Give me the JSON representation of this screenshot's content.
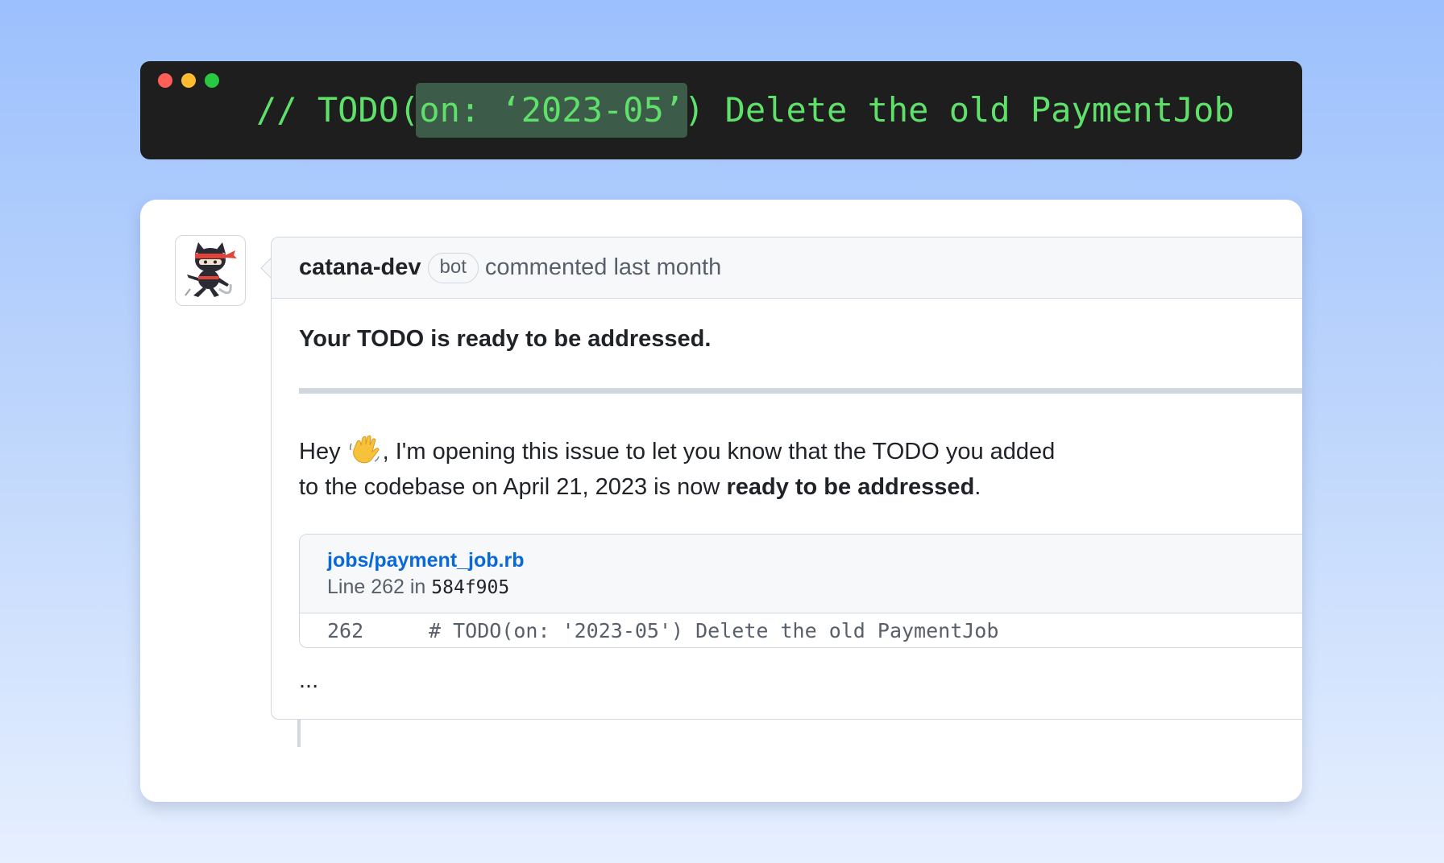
{
  "terminal": {
    "code_prefix": "// TODO(",
    "code_highlight": "on: ‘2023-05’",
    "code_suffix": ") Delete the old PaymentJob"
  },
  "comment": {
    "author": "catana-dev",
    "badge": "bot",
    "action": "commented last month",
    "headline": "Your TODO is ready to be addressed.",
    "body_part1": "Hey ",
    "body_part2": ", I'm opening this issue to let you know that the TODO you added",
    "body_part3": "to the codebase on April 21, 2023 is now ",
    "body_bold": "ready to be addressed",
    "body_end": ".",
    "ellipsis": "..."
  },
  "file_ref": {
    "path": "jobs/payment_job.rb",
    "meta_prefix": "Line 262 in ",
    "sha": "584f905",
    "line_number": "262",
    "code": "# TODO(on: '2023-05') Delete the old PaymentJob"
  },
  "icons": {
    "avatar": "ninja-cat-avatar",
    "wave": "waving-hand-emoji"
  },
  "colors": {
    "code_green": "#5ee06a",
    "link_blue": "#0969da",
    "terminal_bg": "#1e1e1e"
  }
}
